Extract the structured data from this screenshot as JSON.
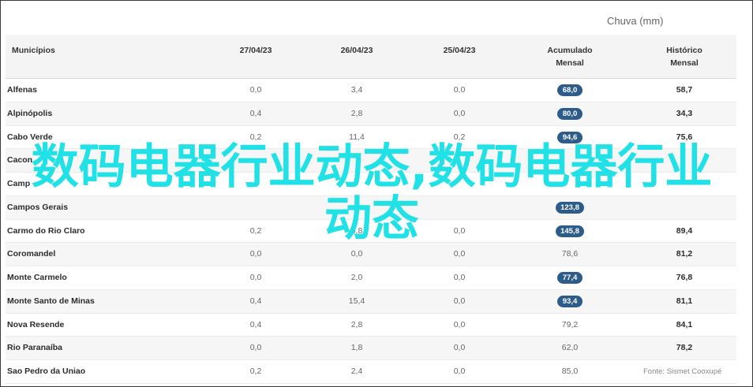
{
  "unit_label": "Chuva (mm)",
  "headers": {
    "municipios": "Municípios",
    "d1": "27/04/23",
    "d2": "26/04/23",
    "d3": "25/04/23",
    "acumulado_l1": "Acumulado",
    "acumulado_l2": "Mensal",
    "historico_l1": "Histórico",
    "historico_l2": "Mensal"
  },
  "rows": [
    {
      "name": "Alfenas",
      "d1": "0,0",
      "d2": "3,4",
      "d3": "0,0",
      "acumulado": "68,0",
      "show_acumulado": true,
      "historico": "58,7"
    },
    {
      "name": "Alpinópolis",
      "d1": "0,4",
      "d2": "2,8",
      "d3": "0,0",
      "acumulado": "80,0",
      "show_acumulado": true,
      "historico": "34,3"
    },
    {
      "name": "Cabo Verde",
      "d1": "0,2",
      "d2": "11,4",
      "d3": "0,2",
      "acumulado": "94,6",
      "show_acumulado": true,
      "historico": "75,6"
    },
    {
      "name": "Cacon",
      "d1": "",
      "d2": "",
      "d3": "",
      "acumulado": "",
      "show_acumulado": false,
      "historico": ""
    },
    {
      "name": "Camp",
      "d1": "",
      "d2": "",
      "d3": "",
      "acumulado": "",
      "show_acumulado": false,
      "historico": ""
    },
    {
      "name": "Campos Gerais",
      "d1": "",
      "d2": "",
      "d3": "",
      "acumulado": "123,8",
      "show_acumulado": true,
      "historico": ""
    },
    {
      "name": "Carmo do Rio Claro",
      "d1": "0,2",
      "d2": "9,8",
      "d3": "0,0",
      "acumulado": "145,8",
      "show_acumulado": true,
      "historico": "89,4"
    },
    {
      "name": "Coromandel",
      "d1": "0,0",
      "d2": "0,0",
      "d3": "0,0",
      "acumulado": "78,6",
      "show_acumulado": false,
      "historico": "81,2"
    },
    {
      "name": "Monte Carmelo",
      "d1": "0,0",
      "d2": "2,0",
      "d3": "0,0",
      "acumulado": "77,4",
      "show_acumulado": true,
      "historico": "76,8"
    },
    {
      "name": "Monte Santo de Minas",
      "d1": "0,4",
      "d2": "15,4",
      "d3": "0,0",
      "acumulado": "93,4",
      "show_acumulado": true,
      "historico": "81,1"
    },
    {
      "name": "Nova Resende",
      "d1": "0,4",
      "d2": "2,8",
      "d3": "0,0",
      "acumulado": "79,2",
      "show_acumulado": false,
      "historico": "84,1"
    },
    {
      "name": "Rio Paranaíba",
      "d1": "0,0",
      "d2": "1,8",
      "d3": "0,0",
      "acumulado": "62,0",
      "show_acumulado": false,
      "historico": "78,2"
    },
    {
      "name": "Sao Pedro da Uniao",
      "d1": "0,2",
      "d2": "2,4",
      "d3": "0,0",
      "acumulado": "85,0",
      "show_acumulado": false,
      "historico": ""
    }
  ],
  "source": "Fonte: Sismet Cooxupé",
  "overlay_text": "数码电器行业动态,数码电器行业动态",
  "colors": {
    "pill": "#2e5c8a",
    "overlay": "#1fe1e6",
    "header_bg": "#f4f4f4"
  }
}
